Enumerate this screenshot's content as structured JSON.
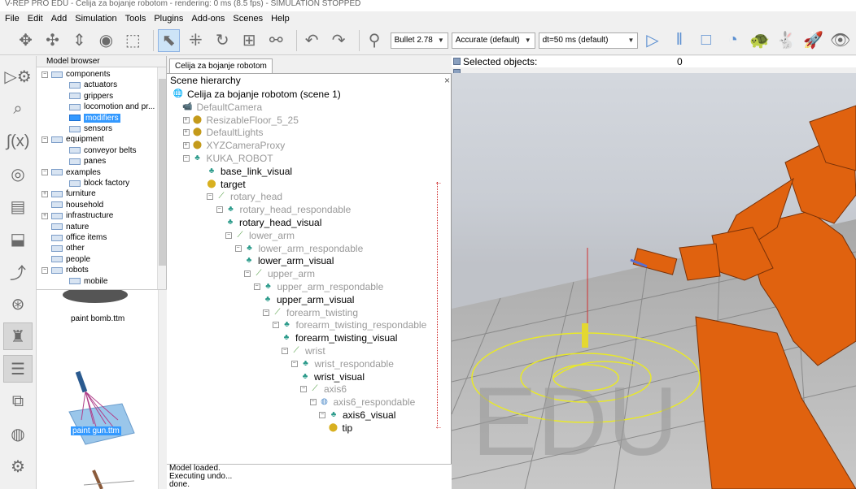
{
  "window": {
    "title": "V-REP PRO EDU - Celija za bojanje robotom - rendering: 0 ms (8.5 fps) - SIMULATION STOPPED"
  },
  "menu": [
    "File",
    "Edit",
    "Add",
    "Simulation",
    "Tools",
    "Plugins",
    "Add-ons",
    "Scenes",
    "Help"
  ],
  "toolbar": {
    "engine": "Bullet 2.78",
    "accuracy": "Accurate (default)",
    "dt": "dt=50 ms (default)"
  },
  "model_browser": {
    "title": "Model browser",
    "tree": [
      {
        "label": "components",
        "depth": 0,
        "expander": "−"
      },
      {
        "label": "actuators",
        "depth": 1
      },
      {
        "label": "grippers",
        "depth": 1
      },
      {
        "label": "locomotion and pr...",
        "depth": 1
      },
      {
        "label": "modifiers",
        "depth": 1,
        "selected": true
      },
      {
        "label": "sensors",
        "depth": 1
      },
      {
        "label": "equipment",
        "depth": 0,
        "expander": "−"
      },
      {
        "label": "conveyor belts",
        "depth": 1
      },
      {
        "label": "panes",
        "depth": 1
      },
      {
        "label": "examples",
        "depth": 0,
        "expander": "−"
      },
      {
        "label": "block factory",
        "depth": 1
      },
      {
        "label": "furniture",
        "depth": 0,
        "expander": "+"
      },
      {
        "label": "household",
        "depth": 0
      },
      {
        "label": "infrastructure",
        "depth": 0,
        "expander": "+"
      },
      {
        "label": "nature",
        "depth": 0
      },
      {
        "label": "office items",
        "depth": 0
      },
      {
        "label": "other",
        "depth": 0
      },
      {
        "label": "people",
        "depth": 0
      },
      {
        "label": "robots",
        "depth": 0,
        "expander": "−"
      },
      {
        "label": "mobile",
        "depth": 1
      }
    ],
    "thumbnails": [
      {
        "label": "paint bomb.ttm"
      },
      {
        "label": "paint gun.ttm",
        "selected": true
      }
    ]
  },
  "scene": {
    "tab": "Celija za bojanje robotom",
    "hierarchy_title": "Scene hierarchy",
    "close": "×",
    "rows": [
      {
        "label": "Celija za bojanje robotom (scene 1)",
        "depth": 0,
        "icon": "globe",
        "dim": false
      },
      {
        "label": "DefaultCamera",
        "depth": 1,
        "icon": "camera",
        "dim": true
      },
      {
        "label": "ResizableFloor_5_25",
        "depth": 1,
        "icon": "shape",
        "dim": true,
        "exp": "+"
      },
      {
        "label": "DefaultLights",
        "depth": 1,
        "icon": "shape",
        "dim": true,
        "exp": "+"
      },
      {
        "label": "XYZCameraProxy",
        "depth": 1,
        "icon": "shape",
        "dim": true,
        "exp": "+"
      },
      {
        "label": "KUKA_ROBOT",
        "depth": 1,
        "icon": "robot",
        "dim": true,
        "exp": "−"
      },
      {
        "label": "base_link_visual",
        "depth": 2,
        "icon": "robot",
        "dim": false
      },
      {
        "label": "target",
        "depth": 2,
        "icon": "dummy",
        "dim": false
      },
      {
        "label": "rotary_head",
        "depth": 2,
        "icon": "joint",
        "dim": true,
        "exp": "−"
      },
      {
        "label": "rotary_head_respondable",
        "depth": 3,
        "icon": "robot",
        "dim": true,
        "exp": "−"
      },
      {
        "label": "rotary_head_visual",
        "depth": 4,
        "icon": "robot",
        "dim": false
      },
      {
        "label": "lower_arm",
        "depth": 4,
        "icon": "joint",
        "dim": true,
        "exp": "−"
      },
      {
        "label": "lower_arm_respondable",
        "depth": 5,
        "icon": "robot",
        "dim": true,
        "exp": "−"
      },
      {
        "label": "lower_arm_visual",
        "depth": 6,
        "icon": "robot",
        "dim": false
      },
      {
        "label": "upper_arm",
        "depth": 6,
        "icon": "joint",
        "dim": true,
        "exp": "−"
      },
      {
        "label": "upper_arm_respondable",
        "depth": 7,
        "icon": "robot",
        "dim": true,
        "exp": "−"
      },
      {
        "label": "upper_arm_visual",
        "depth": 8,
        "icon": "robot",
        "dim": false
      },
      {
        "label": "forearm_twisting",
        "depth": 8,
        "icon": "joint",
        "dim": true,
        "exp": "−"
      },
      {
        "label": "forearm_twisting_respondable",
        "depth": 9,
        "icon": "robot",
        "dim": true,
        "exp": "−"
      },
      {
        "label": "forearm_twisting_visual",
        "depth": 10,
        "icon": "robot",
        "dim": false
      },
      {
        "label": "wrist",
        "depth": 10,
        "icon": "joint",
        "dim": true,
        "exp": "−"
      },
      {
        "label": "wrist_respondable",
        "depth": 11,
        "icon": "robot",
        "dim": true,
        "exp": "−"
      },
      {
        "label": "wrist_visual",
        "depth": 12,
        "icon": "robot",
        "dim": false
      },
      {
        "label": "axis6",
        "depth": 12,
        "icon": "joint",
        "dim": true,
        "exp": "−"
      },
      {
        "label": "axis6_respondable",
        "depth": 13,
        "icon": "drop",
        "dim": true,
        "exp": "−"
      },
      {
        "label": "axis6_visual",
        "depth": 14,
        "icon": "robot",
        "dim": false,
        "exp": "−"
      },
      {
        "label": "tip",
        "depth": 15,
        "icon": "dummy",
        "dim": false
      }
    ]
  },
  "status": {
    "lines": [
      "Model loaded.",
      "Executing undo...",
      "done."
    ]
  },
  "viewport": {
    "selected_label": "Selected objects:",
    "selected_count": "0",
    "watermark": "EDU",
    "robot_color": "#e0620f",
    "path_color": "#e8e82a"
  }
}
